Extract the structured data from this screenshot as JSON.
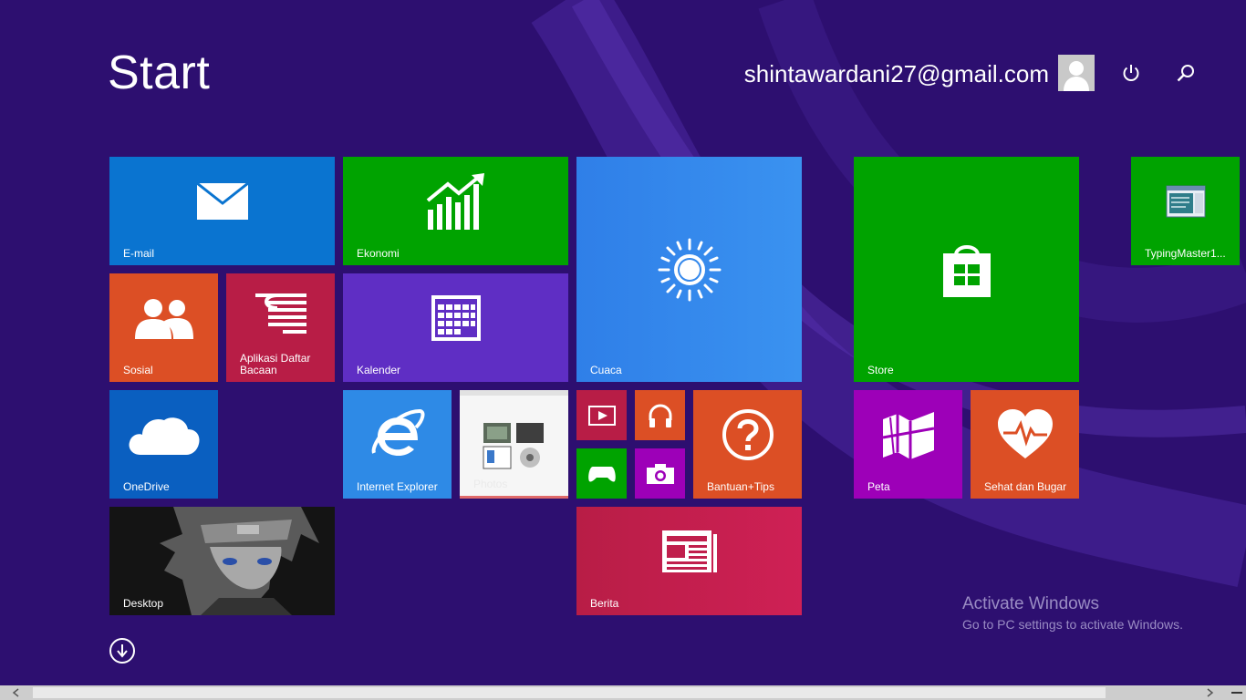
{
  "header": {
    "title": "Start",
    "user_email": "shintawardani27@gmail.com"
  },
  "colors": {
    "background": "#2d0f70",
    "blue": "#0a74d0",
    "green": "#00a300",
    "orange": "#dc4f25",
    "crimson": "#b81d46",
    "purple": "#5f2ec4",
    "sky": "#2e8ae6",
    "magenta": "#9d00b8"
  },
  "tiles": [
    {
      "name": "tile-email",
      "label": "E-mail",
      "icon": "mail-icon"
    },
    {
      "name": "tile-ekonomi",
      "label": "Ekonomi",
      "icon": "chart-up-icon"
    },
    {
      "name": "tile-cuaca",
      "label": "Cuaca",
      "icon": "sun-icon"
    },
    {
      "name": "tile-store",
      "label": "Store",
      "icon": "store-bag-icon"
    },
    {
      "name": "tile-typingmaster",
      "label": "TypingMaster1...",
      "icon": "app-window-icon"
    },
    {
      "name": "tile-sosial",
      "label": "Sosial",
      "icon": "people-icon"
    },
    {
      "name": "tile-daftar-bacaan",
      "label": "Aplikasi Daftar Bacaan",
      "icon": "reading-list-icon"
    },
    {
      "name": "tile-kalender",
      "label": "Kalender",
      "icon": "calendar-icon"
    },
    {
      "name": "tile-onedrive",
      "label": "OneDrive",
      "icon": "cloud-icon"
    },
    {
      "name": "tile-ie",
      "label": "Internet Explorer",
      "icon": "ie-icon"
    },
    {
      "name": "tile-photos",
      "label": "Photos",
      "icon": "photos-thumbnail"
    },
    {
      "name": "tile-video",
      "label": "",
      "icon": "video-icon"
    },
    {
      "name": "tile-music",
      "label": "",
      "icon": "headphones-icon"
    },
    {
      "name": "tile-games",
      "label": "",
      "icon": "gamepad-icon"
    },
    {
      "name": "tile-camera",
      "label": "",
      "icon": "camera-icon"
    },
    {
      "name": "tile-bantuan",
      "label": "Bantuan+Tips",
      "icon": "question-icon"
    },
    {
      "name": "tile-peta",
      "label": "Peta",
      "icon": "map-icon"
    },
    {
      "name": "tile-sehat",
      "label": "Sehat dan Bugar",
      "icon": "heart-pulse-icon"
    },
    {
      "name": "tile-desktop",
      "label": "Desktop",
      "icon": "desktop-wallpaper"
    },
    {
      "name": "tile-berita",
      "label": "Berita",
      "icon": "news-icon"
    }
  ],
  "watermark": {
    "title": "Activate Windows",
    "subtitle": "Go to PC settings to activate Windows."
  }
}
